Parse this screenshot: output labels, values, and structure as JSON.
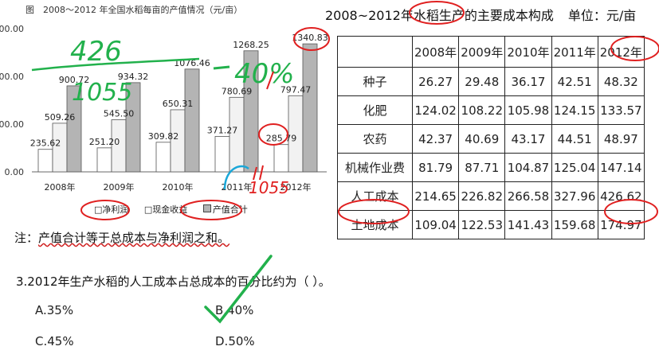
{
  "chart_title": "图　2008～2012 年全国水稻每亩的产值情况（元/亩）",
  "chart_data": {
    "type": "bar",
    "categories": [
      "2008年",
      "2009年",
      "2010年",
      "2011年",
      "2012年"
    ],
    "series": [
      {
        "name": "净利润",
        "values": [
          235.62,
          251.2,
          309.82,
          371.27,
          285.79
        ],
        "color": "#ffffff"
      },
      {
        "name": "现金收益",
        "values": [
          509.26,
          545.5,
          650.31,
          780.69,
          797.47
        ],
        "color": "#f2f2f2"
      },
      {
        "name": "产值合计",
        "values": [
          900.72,
          934.32,
          1076.46,
          1268.25,
          1340.83
        ],
        "color": "#b4b4b4"
      }
    ],
    "y_ticks": [
      "00.00",
      "00.00",
      "00.00",
      "0.00"
    ],
    "ylim": [
      0,
      1500
    ],
    "legend_position": "bottom"
  },
  "legend": {
    "items": [
      {
        "label": "净利润"
      },
      {
        "label": "现金收益"
      },
      {
        "label": "产值合计"
      }
    ]
  },
  "note": {
    "prefix": "注：",
    "text": "产值合计等于总成本与净利润之和。"
  },
  "table": {
    "title": "2008~2012年水稻生产的主要成本构成",
    "unit": "单位：元/亩",
    "years": [
      "2008年",
      "2009年",
      "2010年",
      "2011年",
      "2012年"
    ],
    "rows": [
      {
        "label": "种子",
        "values": [
          "26.27",
          "29.48",
          "36.17",
          "42.51",
          "48.32"
        ]
      },
      {
        "label": "化肥",
        "values": [
          "124.02",
          "108.22",
          "105.98",
          "124.15",
          "133.57"
        ]
      },
      {
        "label": "农药",
        "values": [
          "42.37",
          "40.69",
          "43.17",
          "44.51",
          "48.97"
        ]
      },
      {
        "label": "机械作业费",
        "values": [
          "81.79",
          "87.71",
          "104.87",
          "125.04",
          "147.14"
        ]
      },
      {
        "label": "人工成本",
        "values": [
          "214.65",
          "226.82",
          "266.58",
          "327.96",
          "426.62"
        ]
      },
      {
        "label": "土地成本",
        "values": [
          "109.04",
          "122.53",
          "141.43",
          "159.68",
          "174.97"
        ]
      }
    ]
  },
  "question": "3.2012年生产水稻的人工成本占总成本的百分比约为（   ）。",
  "options": {
    "a": "A.35%",
    "b": "B.40%",
    "c": "C.45%",
    "d": "D.50%"
  },
  "annotations": {
    "fraction_top": "426",
    "fraction_bottom": "1055",
    "percent": "40%",
    "near_2011": "1055"
  },
  "colors": {
    "ink_green": "#22b14c",
    "ink_red": "#e02020",
    "ink_blue": "#1aa7d8",
    "bar_total": "#b4b4b4"
  }
}
